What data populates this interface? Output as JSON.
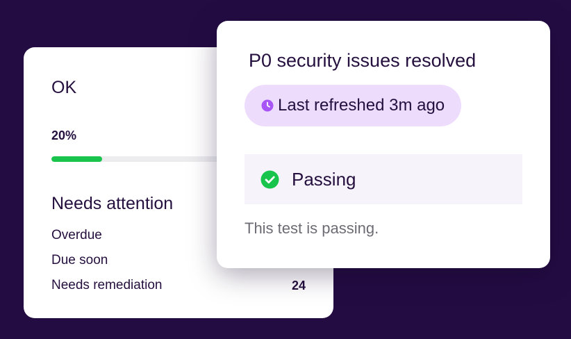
{
  "colors": {
    "background": "#230c42",
    "accent_purple": "#a855f7",
    "success_green": "#18c44b",
    "pill_bg": "#eedcfd"
  },
  "summary_card": {
    "status": "OK",
    "progress": {
      "label": "20%",
      "value_percent": 20
    },
    "attention": {
      "title": "Needs attention",
      "rows": [
        {
          "label": "Overdue",
          "count": ""
        },
        {
          "label": "Due soon",
          "count": ""
        },
        {
          "label": "Needs remediation",
          "count": "24"
        }
      ]
    }
  },
  "test_card": {
    "title": "P0 security issues resolved",
    "refresh": {
      "icon": "clock-icon",
      "text": "Last refreshed 3m ago"
    },
    "result": {
      "icon": "check-circle-icon",
      "label": "Passing"
    },
    "description": "This test is passing."
  }
}
